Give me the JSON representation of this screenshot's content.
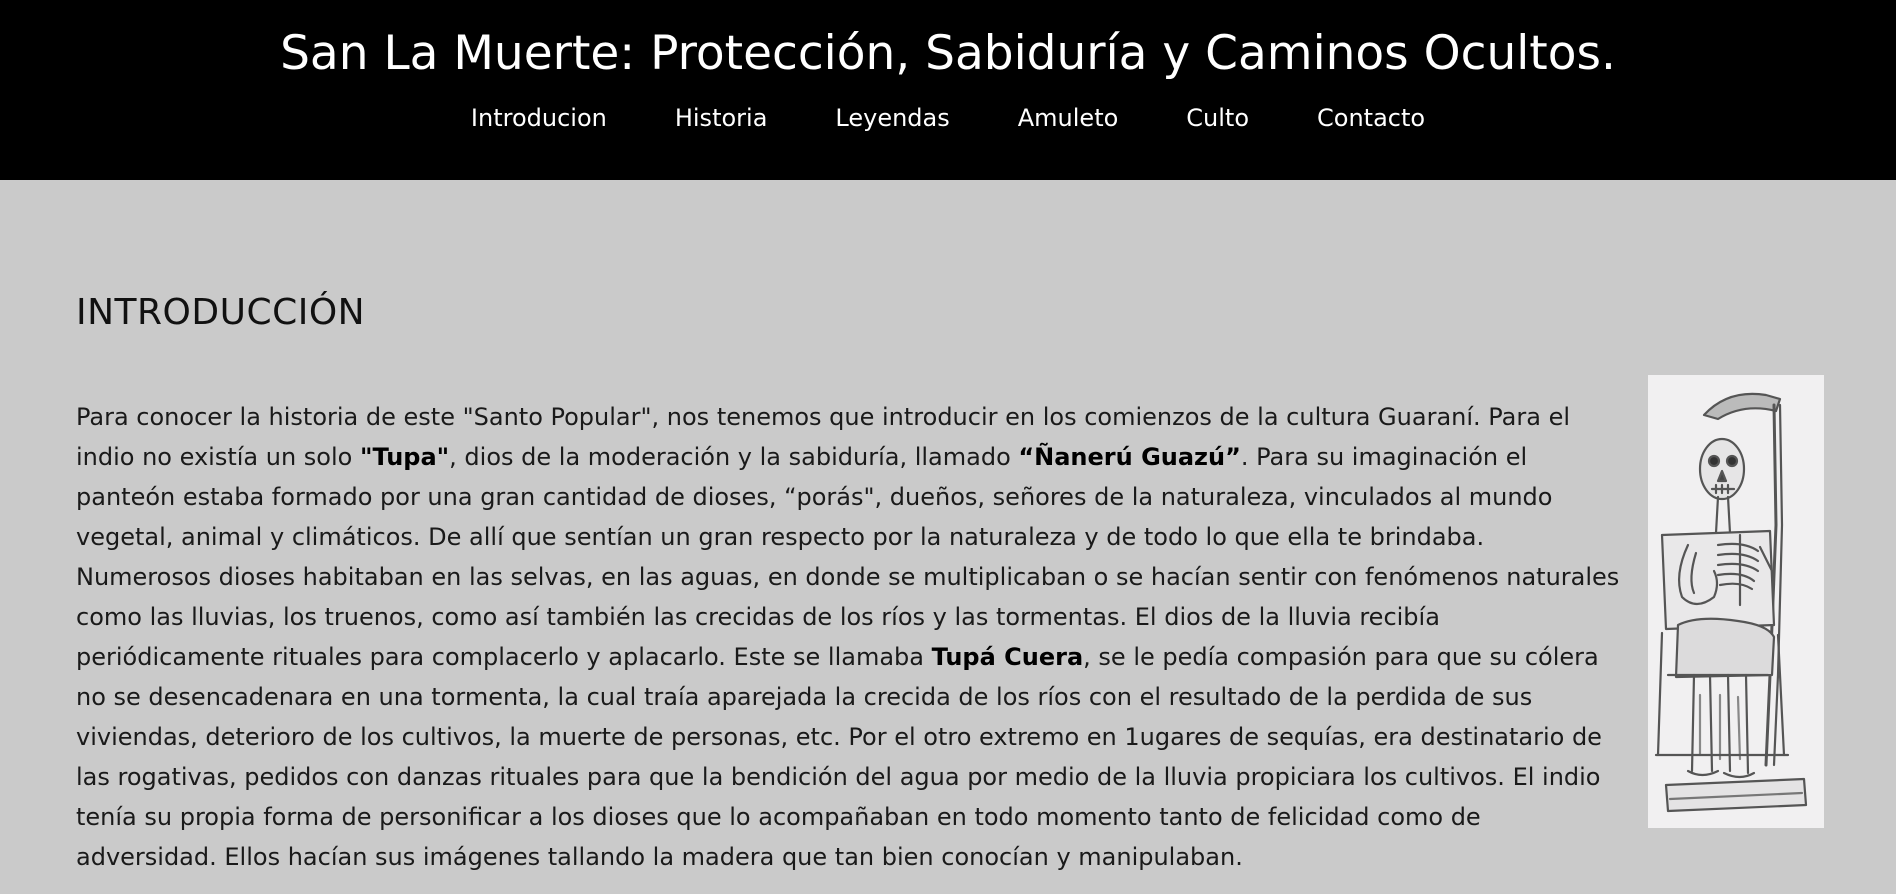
{
  "header": {
    "title": "San La Muerte: Protección, Sabiduría y Caminos Ocultos."
  },
  "nav": {
    "items": [
      {
        "label": "Introducion"
      },
      {
        "label": "Historia"
      },
      {
        "label": "Leyendas"
      },
      {
        "label": "Amuleto"
      },
      {
        "label": "Culto"
      },
      {
        "label": "Contacto"
      }
    ]
  },
  "intro": {
    "heading": "INTRODUCCIÓN",
    "p1": "Para conocer la historia de este \"Santo Popular\", nos tenemos que introducir en los comienzos de la cultura Guaraní. Para el indio no existía un solo ",
    "b1": "\"Tupa\"",
    "p2": ", dios de la moderación y la sabiduría, llamado ",
    "b2": "“Ñanerú Guazú”",
    "p3": ". Para su imaginación el panteón estaba formado por una gran cantidad de dioses, “porás\", dueños, señores de la naturaleza, vinculados al mundo vegetal, animal y climáticos. De allí que sentían un gran respecto por la naturaleza y de todo lo que ella te brindaba. Numerosos dioses habitaban en las selvas, en las aguas, en donde se multiplicaban o se hacían sentir con fenómenos naturales como las lluvias, los truenos, como así también las crecidas de los ríos y las tormentas. El dios de la lluvia recibía periódicamente rituales para complacerlo y aplacarlo. Este se llamaba ",
    "b3": "Tupá Cuera",
    "p4": ", se le pedía compasión para que su cólera no se desencadenara en una tormenta, la cual traía aparejada la crecida de los ríos con el resultado de la perdida de sus viviendas, deterioro de los cultivos, la muerte de personas, etc. Por el otro extremo en 1ugares de sequías, era destinatario de las rogativas, pedidos con danzas rituales para que la bendición del agua por medio de la lluvia propiciara los cultivos. El indio tenía su propia forma de personificar a los dioses que lo acompañaban en todo momento tanto de felicidad como de adversidad. Ellos hacían sus imágenes tallando la madera que tan bien conocían y manipulaban."
  }
}
